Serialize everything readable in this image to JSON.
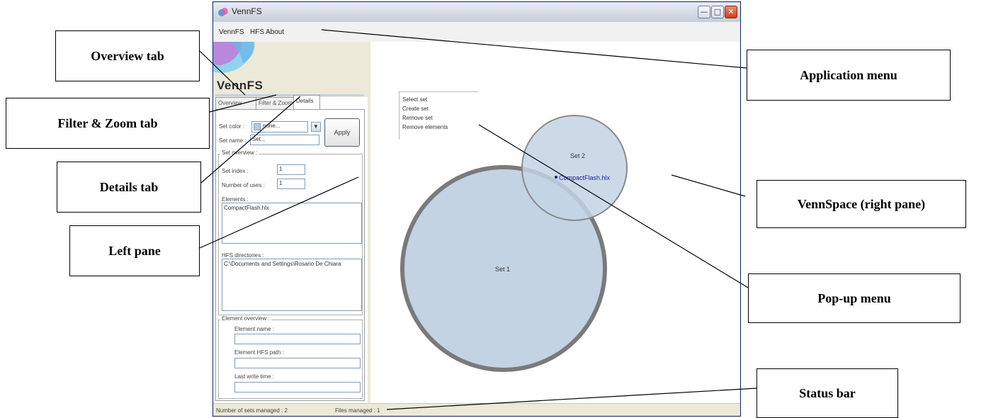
{
  "window": {
    "title": "VennFS"
  },
  "menu": {
    "items": [
      "VennFS",
      "HFS",
      "About"
    ]
  },
  "app_name": "VennFS",
  "tabs": [
    "Overview",
    "Filter & Zoom",
    "Details"
  ],
  "details": {
    "set_color_label": "Set color :",
    "set_color_value": "none...",
    "set_name_label": "Set name :",
    "set_name_value": "Set...",
    "apply_button": "Apply",
    "set_overview_title": "Set overview :",
    "set_index_label": "Set index :",
    "set_index_value": "1",
    "number_of_uses_label": "Number of uses :",
    "number_of_uses_value": "1",
    "elements_label": "Elements :",
    "elements_items": [
      "CompactFlash.hlx"
    ],
    "hfs_directories_label": "HFS directories :",
    "hfs_directories_items": [
      "C:\\Documents and Settings\\Rosario De Chiara"
    ],
    "element_overview_title": "Element overview :",
    "element_name_label": "Element name :",
    "element_hfs_path_label": "Element HFS path :",
    "last_write_time_label": "Last write time :"
  },
  "status": {
    "sets_managed": "Number of sets managed : 2",
    "files_managed": "Files managed : 1"
  },
  "popup_menu": {
    "items": [
      "Select set",
      "Create set",
      "Remove set",
      "Remove elements"
    ]
  },
  "venn": {
    "sets": [
      {
        "label": "Set 1",
        "fill": "#c3d3e4",
        "stroke": "#7a7a7a"
      },
      {
        "label": "Set 2",
        "fill": "#c3d3e4",
        "stroke": "#8a8a8a",
        "element": "CompactFlash.hlx"
      }
    ],
    "element_color": "#1a1aa6"
  },
  "callouts": {
    "overview_tab": "Overview tab",
    "filter_zoom_tab": "Filter & Zoom tab",
    "details_tab": "Details tab",
    "left_pane": "Left pane",
    "application_menu": "Application menu",
    "vennspace": "VennSpace (right pane)",
    "popup_menu": "Pop-up menu",
    "status_bar": "Status bar"
  }
}
